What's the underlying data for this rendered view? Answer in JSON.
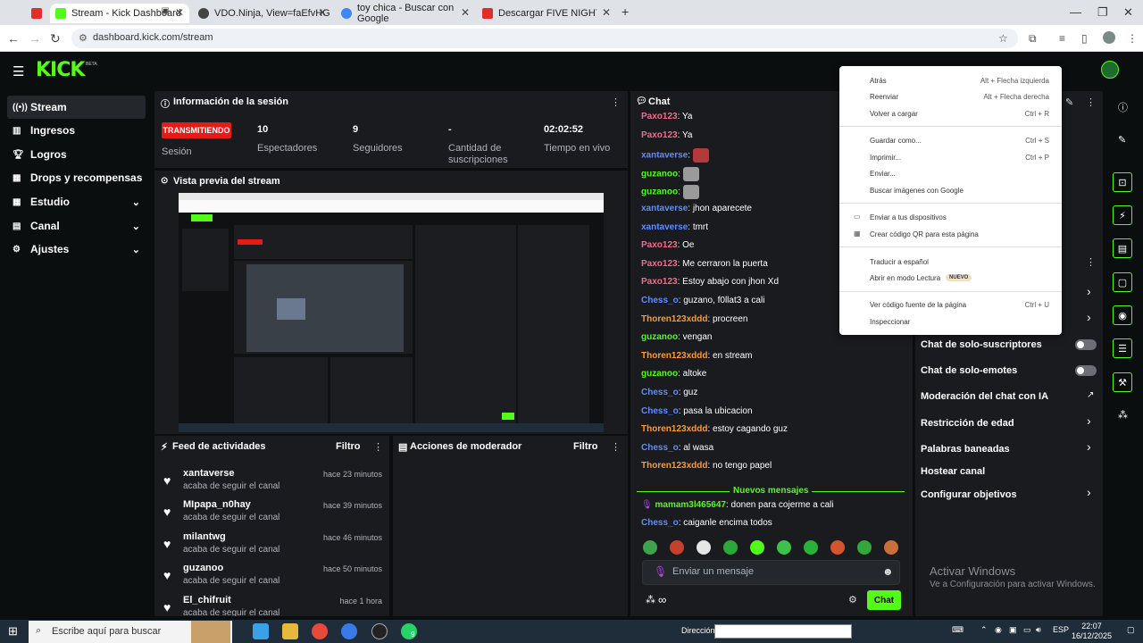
{
  "browser": {
    "tabs": [
      {
        "title": "",
        "color": "#e52d27"
      },
      {
        "title": "Stream - Kick Dashboard",
        "color": "#53fc18"
      },
      {
        "title": "VDO.Ninja, View=faEfvHG",
        "color": "#444"
      },
      {
        "title": "toy chica - Buscar con Google",
        "color": "#4285f4"
      },
      {
        "title": "Descargar FIVE NIGHTS AT FRE",
        "color": "#e52d27"
      }
    ],
    "new_tab": "+",
    "url": "dashboard.kick.com/stream"
  },
  "kick": {
    "logo": "KICK",
    "beta": "BETA"
  },
  "sidebar": {
    "items": [
      {
        "label": "Stream",
        "icon": "broadcast-icon"
      },
      {
        "label": "Ingresos",
        "icon": "chart-icon"
      },
      {
        "label": "Logros",
        "icon": "trophy-icon"
      },
      {
        "label": "Drops y recompensas",
        "icon": "gift-icon"
      },
      {
        "label": "Estudio",
        "icon": "grid-icon"
      },
      {
        "label": "Canal",
        "icon": "channel-icon"
      },
      {
        "label": "Ajustes",
        "icon": "gear-icon"
      }
    ]
  },
  "session": {
    "title": "Información de la sesión",
    "live_badge": "TRANSMITIENDO",
    "session_label": "Sesión",
    "stats": [
      {
        "value": "10",
        "label": "Espectadores"
      },
      {
        "value": "9",
        "label": "Seguidores"
      },
      {
        "value": "-",
        "label": "Cantidad de suscripciones"
      },
      {
        "value": "02:02:52",
        "label": "Tiempo en vivo"
      }
    ]
  },
  "preview": {
    "title": "Vista previa del stream"
  },
  "feed": {
    "title": "Feed de actividades",
    "filter": "Filtro",
    "items": [
      {
        "name": "xantaverse",
        "action": "acaba de seguir el canal",
        "time": "hace 23 minutos"
      },
      {
        "name": "MIpapa_n0hay",
        "action": "acaba de seguir el canal",
        "time": "hace 39 minutos"
      },
      {
        "name": "milantwg",
        "action": "acaba de seguir el canal",
        "time": "hace 46 minutos"
      },
      {
        "name": "guzanoo",
        "action": "acaba de seguir el canal",
        "time": "hace 50 minutos"
      },
      {
        "name": "El_chifruit",
        "action": "acaba de seguir el canal",
        "time": "hace 1 hora"
      }
    ]
  },
  "mod_actions": {
    "title": "Acciones de moderador",
    "filter": "Filtro"
  },
  "chat": {
    "title": "Chat",
    "messages": [
      {
        "user": "Paxo123",
        "color": "#f26d8c",
        "text": ": Ya"
      },
      {
        "user": "Paxo123",
        "color": "#f26d8c",
        "text": ": Ya"
      },
      {
        "user": "xantaverse",
        "color": "#5f8dff",
        "text": ":",
        "emote": "#b33a3a"
      },
      {
        "user": "guzanoo",
        "color": "#53fc18",
        "text": ":",
        "emote": "#9a9a9a"
      },
      {
        "user": "guzanoo",
        "color": "#53fc18",
        "text": ":",
        "emote": "#9a9a9a"
      },
      {
        "user": "xantaverse",
        "color": "#5f8dff",
        "text": ": jhon aparecete"
      },
      {
        "user": "xantaverse",
        "color": "#5f8dff",
        "text": ": tmrt"
      },
      {
        "user": "Paxo123",
        "color": "#f26d8c",
        "text": ": Oe"
      },
      {
        "user": "Paxo123",
        "color": "#f26d8c",
        "text": ": Me cerraron la puerta"
      },
      {
        "user": "Paxo123",
        "color": "#f26d8c",
        "text": ": Estoy abajo con jhon Xd"
      },
      {
        "user": "Chess_o",
        "color": "#5f8dff",
        "text": ": guzano, f0llat3 a cali"
      },
      {
        "user": "Thoren123xddd",
        "color": "#ff9a2e",
        "text": ": procreen"
      },
      {
        "user": "guzanoo",
        "color": "#53fc18",
        "text": ": vengan"
      },
      {
        "user": "Thoren123xddd",
        "color": "#ff9a2e",
        "text": ": en stream"
      },
      {
        "user": "guzanoo",
        "color": "#53fc18",
        "text": ": altoke"
      },
      {
        "user": "Chess_o",
        "color": "#5f8dff",
        "text": ": guz"
      },
      {
        "user": "Chess_o",
        "color": "#5f8dff",
        "text": ": pasa la ubicacion"
      },
      {
        "user": "Thoren123xddd",
        "color": "#ff9a2e",
        "text": ": estoy cagando guz"
      },
      {
        "user": "Chess_o",
        "color": "#5f8dff",
        "text": ": al wasa"
      },
      {
        "user": "Thoren123xddd",
        "color": "#ff9a2e",
        "text": ": no tengo papel"
      }
    ],
    "new_messages": "Nuevos mensajes",
    "after": [
      {
        "user": "mamam3l465647",
        "color": "#53fc18",
        "text": ": donen para cojerme a cali"
      },
      {
        "user": "Chess_o",
        "color": "#5f8dff",
        "text": ": caiganle encima todos"
      }
    ],
    "input_placeholder": "Enviar un mensaje",
    "send": "Chat",
    "infinity": "∞"
  },
  "chat_settings": [
    {
      "label": "Chat de solo-suscriptores",
      "type": "toggle"
    },
    {
      "label": "Chat de solo-emotes",
      "type": "toggle"
    },
    {
      "label": "Moderación del chat con IA",
      "type": "link"
    },
    {
      "label": "Restricción de edad",
      "type": "chevron"
    },
    {
      "label": "Palabras baneadas",
      "type": "chevron"
    },
    {
      "label": "Hostear canal",
      "type": "none"
    },
    {
      "label": "Configurar objetivos",
      "type": "chevron"
    }
  ],
  "context_menu": {
    "items": [
      {
        "label": "Atrás",
        "shortcut": "Alt + Flecha izquierda"
      },
      {
        "label": "Reenviar",
        "shortcut": "Alt + Flecha derecha"
      },
      {
        "label": "Volver a cargar",
        "shortcut": "Ctrl + R"
      },
      {
        "label": "Guardar como...",
        "shortcut": "Ctrl + S"
      },
      {
        "label": "Imprimir...",
        "shortcut": "Ctrl + P"
      },
      {
        "label": "Enviar...",
        "shortcut": ""
      },
      {
        "label": "Buscar imágenes con Google",
        "shortcut": ""
      },
      {
        "label": "Enviar a tus dispositivos",
        "shortcut": ""
      },
      {
        "label": "Crear código QR para esta página",
        "shortcut": ""
      },
      {
        "label": "Traducir a español",
        "shortcut": ""
      },
      {
        "label": "Abrir en modo Lectura",
        "shortcut": ""
      },
      {
        "label": "Ver código fuente de la página",
        "shortcut": "Ctrl + U"
      },
      {
        "label": "Inspeccionar",
        "shortcut": ""
      }
    ],
    "badge": "NUEVO"
  },
  "activate_windows": {
    "title": "Activar Windows",
    "subtitle": "Ve a Configuración para activar Windows."
  },
  "taskbar": {
    "search_placeholder": "Escribe aquí para buscar",
    "direccion": "Dirección",
    "lang": "ESP",
    "time": "22:07",
    "date": "16/12/2025",
    "whatsapp_count": "9"
  }
}
